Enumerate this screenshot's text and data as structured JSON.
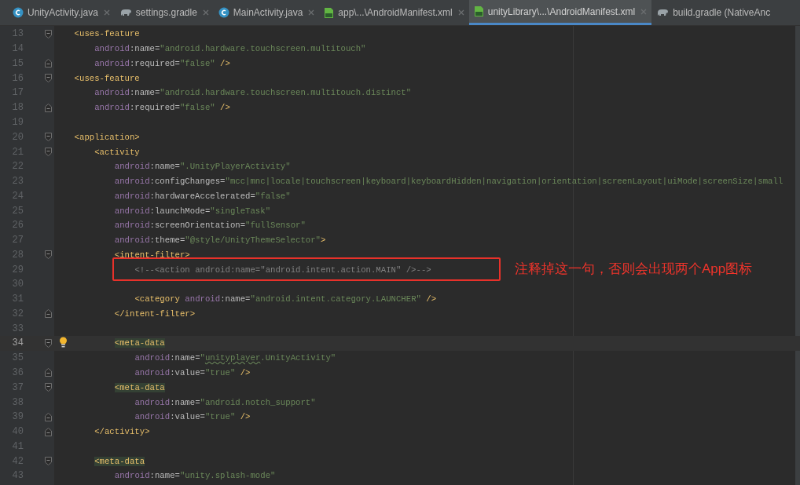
{
  "tabs": [
    {
      "label": "UnityActivity.java",
      "kind": "class",
      "selected": false,
      "closable": true
    },
    {
      "label": "settings.gradle",
      "kind": "gradle",
      "selected": false,
      "closable": true
    },
    {
      "label": "MainActivity.java",
      "kind": "class",
      "selected": false,
      "closable": true
    },
    {
      "label": "app\\...\\AndroidManifest.xml",
      "kind": "manifest",
      "selected": false,
      "closable": true
    },
    {
      "label": "unityLibrary\\...\\AndroidManifest.xml",
      "kind": "manifest",
      "selected": true,
      "closable": true
    },
    {
      "label": "build.gradle (NativeAnc",
      "kind": "gradle",
      "selected": false,
      "closable": false
    }
  ],
  "lines": [
    {
      "number": "13",
      "kind": "opener",
      "current": false,
      "tokens": [
        {
          "kind": "tag",
          "text": "    <uses-feature"
        }
      ]
    },
    {
      "number": "14",
      "kind": "plain",
      "current": false,
      "tokens": [
        {
          "kind": "ns",
          "text": "        android"
        },
        {
          "kind": "attr",
          "text": ":name="
        },
        {
          "kind": "value",
          "text": "\"android.hardware.touchscreen.multitouch\""
        }
      ]
    },
    {
      "number": "15",
      "kind": "closer",
      "current": false,
      "tokens": [
        {
          "kind": "ns",
          "text": "        android"
        },
        {
          "kind": "attr",
          "text": ":required="
        },
        {
          "kind": "value",
          "text": "\"false\""
        },
        {
          "kind": "tag",
          "text": " />"
        }
      ]
    },
    {
      "number": "16",
      "kind": "opener",
      "current": false,
      "tokens": [
        {
          "kind": "tag",
          "text": "    <uses-feature"
        }
      ]
    },
    {
      "number": "17",
      "kind": "plain",
      "current": false,
      "tokens": [
        {
          "kind": "ns",
          "text": "        android"
        },
        {
          "kind": "attr",
          "text": ":name="
        },
        {
          "kind": "value",
          "text": "\"android.hardware.touchscreen.multitouch.distinct\""
        }
      ]
    },
    {
      "number": "18",
      "kind": "closer",
      "current": false,
      "tokens": [
        {
          "kind": "ns",
          "text": "        android"
        },
        {
          "kind": "attr",
          "text": ":required="
        },
        {
          "kind": "value",
          "text": "\"false\""
        },
        {
          "kind": "tag",
          "text": " />"
        }
      ]
    },
    {
      "number": "19",
      "kind": "plain",
      "current": false
    },
    {
      "number": "20",
      "kind": "opener",
      "current": false,
      "tokens": [
        {
          "kind": "tag",
          "text": "    <application>"
        }
      ]
    },
    {
      "number": "21",
      "kind": "opener",
      "current": false,
      "tokens": [
        {
          "kind": "tag",
          "text": "        <activity"
        }
      ]
    },
    {
      "number": "22",
      "kind": "plain",
      "current": false,
      "tokens": [
        {
          "kind": "ns",
          "text": "            android"
        },
        {
          "kind": "attr",
          "text": ":name="
        },
        {
          "kind": "value",
          "text": "\".UnityPlayerActivity\""
        }
      ]
    },
    {
      "number": "23",
      "kind": "plain",
      "current": false,
      "tokens": [
        {
          "kind": "ns",
          "text": "            android"
        },
        {
          "kind": "attr",
          "text": ":configChanges="
        },
        {
          "kind": "value",
          "text": "\"mcc|mnc|locale|touchscreen|keyboard|keyboardHidden|navigation|orientation|screenLayout|uiMode|screenSize|small"
        }
      ]
    },
    {
      "number": "24",
      "kind": "plain",
      "current": false,
      "tokens": [
        {
          "kind": "ns",
          "text": "            android"
        },
        {
          "kind": "attr",
          "text": ":hardwareAccelerated="
        },
        {
          "kind": "value",
          "text": "\"false\""
        }
      ]
    },
    {
      "number": "25",
      "kind": "plain",
      "current": false,
      "tokens": [
        {
          "kind": "ns",
          "text": "            android"
        },
        {
          "kind": "attr",
          "text": ":launchMode="
        },
        {
          "kind": "value",
          "text": "\"singleTask\""
        }
      ]
    },
    {
      "number": "26",
      "kind": "plain",
      "current": false,
      "tokens": [
        {
          "kind": "ns",
          "text": "            android"
        },
        {
          "kind": "attr",
          "text": ":screenOrientation="
        },
        {
          "kind": "value",
          "text": "\"fullSensor\""
        }
      ]
    },
    {
      "number": "27",
      "kind": "plain",
      "current": false,
      "tokens": [
        {
          "kind": "ns",
          "text": "            android"
        },
        {
          "kind": "attr",
          "text": ":theme="
        },
        {
          "kind": "value",
          "text": "\"@style/UnityThemeSelector\""
        },
        {
          "kind": "tag",
          "text": ">"
        }
      ]
    },
    {
      "number": "28",
      "kind": "opener",
      "current": false,
      "tokens": [
        {
          "kind": "tag",
          "text": "            <intent-filter>"
        }
      ]
    },
    {
      "number": "29",
      "kind": "plain",
      "current": false,
      "callout": "注释掉这一句，否则会出现两个App图标",
      "tokens": [
        {
          "kind": "comment",
          "text": "                <!--<action android:name=\"android.intent.action.MAIN\" />-->"
        }
      ]
    },
    {
      "number": "30",
      "kind": "plain",
      "current": false
    },
    {
      "number": "31",
      "kind": "plain",
      "current": false,
      "tokens": [
        {
          "kind": "tag",
          "text": "                <category"
        },
        {
          "kind": "ns",
          "text": " android"
        },
        {
          "kind": "attr",
          "text": ":name="
        },
        {
          "kind": "value",
          "text": "\"android.intent.category.LAUNCHER\""
        },
        {
          "kind": "tag",
          "text": " />"
        }
      ]
    },
    {
      "number": "32",
      "kind": "closer",
      "current": false,
      "tokens": [
        {
          "kind": "tag",
          "text": "            </intent-filter>"
        }
      ]
    },
    {
      "number": "33",
      "kind": "plain",
      "current": false
    },
    {
      "number": "34",
      "kind": "opener",
      "current": true,
      "bulb": true,
      "tokens": [
        {
          "kind": "matched",
          "text": "            <meta-data"
        }
      ]
    },
    {
      "number": "35",
      "kind": "plain",
      "current": false,
      "tokens": [
        {
          "kind": "ns",
          "text": "                android"
        },
        {
          "kind": "attr",
          "text": ":name="
        },
        {
          "kind": "value",
          "text": "\""
        },
        {
          "kind": "typo",
          "text": "unityplayer"
        },
        {
          "kind": "value",
          "text": ".UnityActivity\""
        }
      ]
    },
    {
      "number": "36",
      "kind": "closer",
      "current": false,
      "tokens": [
        {
          "kind": "ns",
          "text": "                android"
        },
        {
          "kind": "attr",
          "text": ":value="
        },
        {
          "kind": "value",
          "text": "\"true\""
        },
        {
          "kind": "tag",
          "text": " />"
        }
      ]
    },
    {
      "number": "37",
      "kind": "opener",
      "current": false,
      "tokens": [
        {
          "kind": "matched",
          "text": "            <meta-data"
        }
      ]
    },
    {
      "number": "38",
      "kind": "plain",
      "current": false,
      "tokens": [
        {
          "kind": "ns",
          "text": "                android"
        },
        {
          "kind": "attr",
          "text": ":name="
        },
        {
          "kind": "value",
          "text": "\"android.notch_support\""
        }
      ]
    },
    {
      "number": "39",
      "kind": "closer",
      "current": false,
      "tokens": [
        {
          "kind": "ns",
          "text": "                android"
        },
        {
          "kind": "attr",
          "text": ":value="
        },
        {
          "kind": "value",
          "text": "\"true\""
        },
        {
          "kind": "tag",
          "text": " />"
        }
      ]
    },
    {
      "number": "40",
      "kind": "closer",
      "current": false,
      "tokens": [
        {
          "kind": "tag",
          "text": "        </activity>"
        }
      ]
    },
    {
      "number": "41",
      "kind": "plain",
      "current": false
    },
    {
      "number": "42",
      "kind": "opener",
      "current": false,
      "tokens": [
        {
          "kind": "matched",
          "text": "        <meta-data"
        }
      ]
    },
    {
      "number": "43",
      "kind": "plain",
      "current": false,
      "tokens": [
        {
          "kind": "ns",
          "text": "            android"
        },
        {
          "kind": "attr",
          "text": ":name="
        },
        {
          "kind": "value",
          "text": "\"unity.splash-mode\""
        }
      ]
    }
  ]
}
